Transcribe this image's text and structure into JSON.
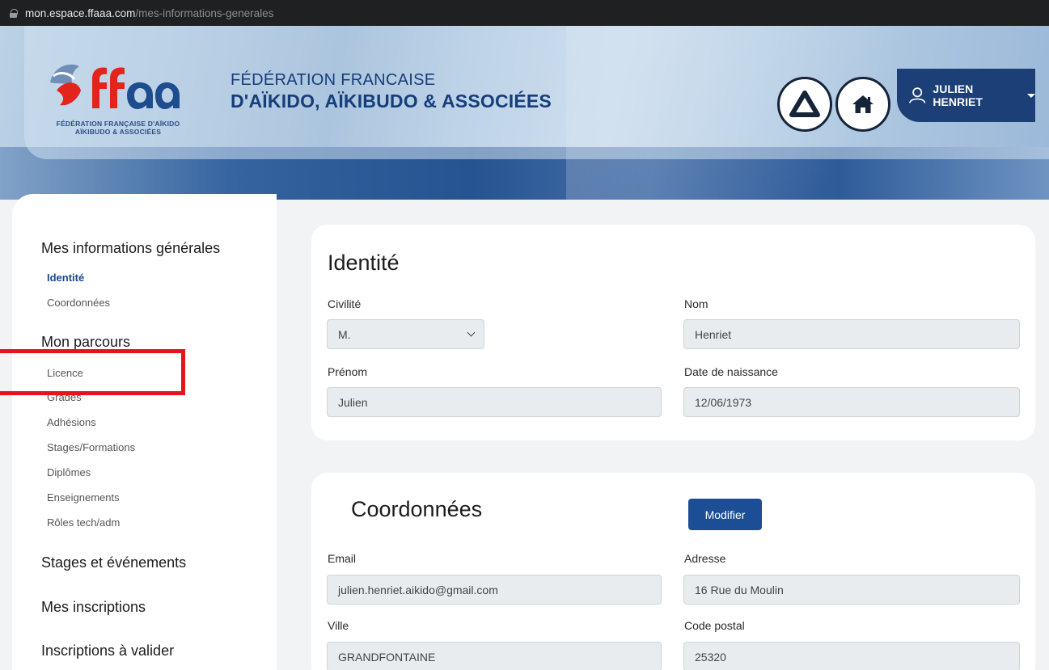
{
  "browser": {
    "host": "mon.espace.ffaaa.com",
    "path": "/mes-informations-generales"
  },
  "header": {
    "logo_sub_line1": "FÉDÉRATION FRANÇAISE D'AÏKIDO",
    "logo_sub_line2": "AÏKIBUDO & ASSOCIÉES",
    "org_line1": "FÉDÉRATION FRANCAISE",
    "org_line2": "D'AÏKIDO, AÏKIBUDO & ASSOCIÉES",
    "user_name": "JULIEN HENRIET",
    "icons": [
      "delta-icon",
      "home-icon",
      "user-icon",
      "caret-down-icon"
    ]
  },
  "sidebar": {
    "sec1": "Mes informations générales",
    "sec1_items": [
      "Identité",
      "Coordonnées"
    ],
    "sec2": "Mon parcours",
    "sec2_items": [
      "Licence",
      "Grades",
      "Adhésions",
      "Stages/Formations",
      "Diplômes",
      "Enseignements",
      "Rôles tech/adm"
    ],
    "sec3": "Stages et événements",
    "sec4": "Mes inscriptions",
    "sec5": "Inscriptions à valider"
  },
  "identite": {
    "title": "Identité",
    "civilite_label": "Civilité",
    "civilite_value": "M.",
    "nom_label": "Nom",
    "nom_value": "Henriet",
    "prenom_label": "Prénom",
    "prenom_value": "Julien",
    "naissance_label": "Date de naissance",
    "naissance_value": "12/06/1973"
  },
  "coordonnees": {
    "title": "Coordonnées",
    "modifier_label": "Modifier",
    "email_label": "Email",
    "email_value": "julien.henriet.aikido@gmail.com",
    "adresse_label": "Adresse",
    "adresse_value": "16 Rue du Moulin",
    "ville_label": "Ville",
    "ville_value": "GRANDFONTAINE",
    "cp_label": "Code postal",
    "cp_value": "25320"
  },
  "colors": {
    "primary": "#1c4e95",
    "navy": "#1b3f76",
    "highlight": "#e8121b",
    "logo_red": "#e2241d"
  }
}
